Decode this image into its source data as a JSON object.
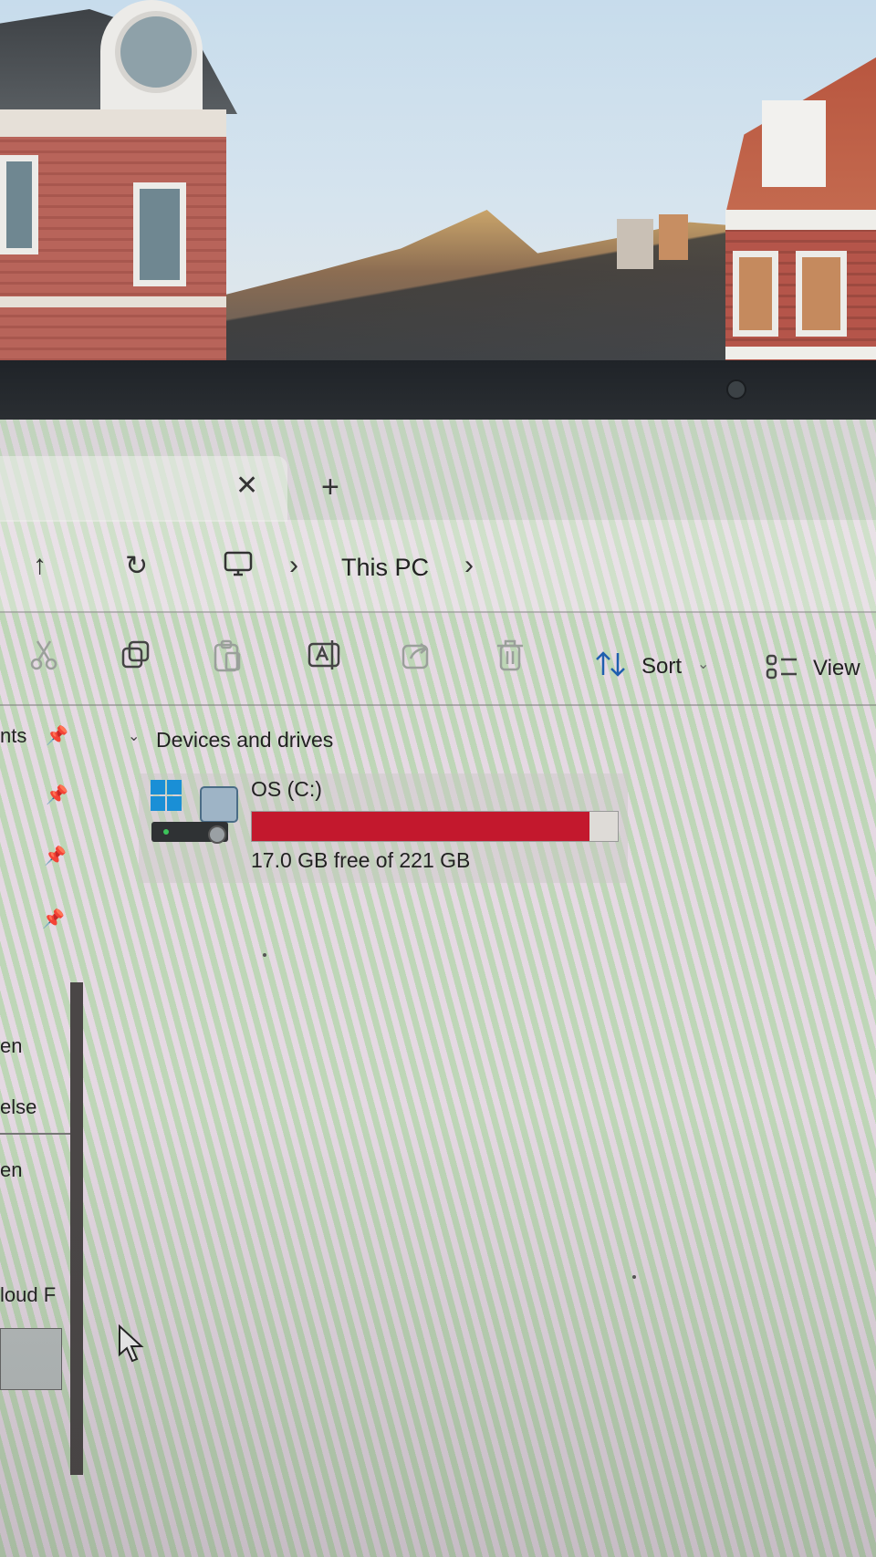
{
  "tabs": {
    "close_glyph": "✕",
    "new_glyph": "+"
  },
  "nav": {
    "up_glyph": "↑",
    "refresh_glyph": "↻",
    "chevron_glyph": "›",
    "breadcrumb_label": "This PC"
  },
  "command_bar": {
    "sort_label": "Sort",
    "sort_chevron": "⌄",
    "view_label": "View",
    "icons": [
      "cut-icon",
      "copy-icon",
      "paste-icon",
      "rename-icon",
      "share-icon",
      "delete-icon",
      "sort-icon",
      "view-icon"
    ]
  },
  "sidebar": {
    "items": [
      {
        "label": "nts",
        "pinned": true
      },
      {
        "label": "",
        "pinned": true
      },
      {
        "label": "",
        "pinned": true
      },
      {
        "label": "",
        "pinned": true
      },
      {
        "label": "en",
        "pinned": false
      },
      {
        "label": "else",
        "pinned": false
      },
      {
        "label": "en",
        "pinned": false
      },
      {
        "label": "loud F",
        "pinned": false
      }
    ]
  },
  "content": {
    "group_label": "Devices and drives",
    "group_chevron": "⌄",
    "drive": {
      "name": "OS (C:)",
      "free_text": "17.0 GB free of 221 GB",
      "used_fraction": 0.923,
      "bar_color": "#c3182d"
    }
  },
  "colors": {
    "bezel": "#23272b",
    "drive_bar": "#c3182d",
    "windows_blue": "#1a8fd6"
  }
}
